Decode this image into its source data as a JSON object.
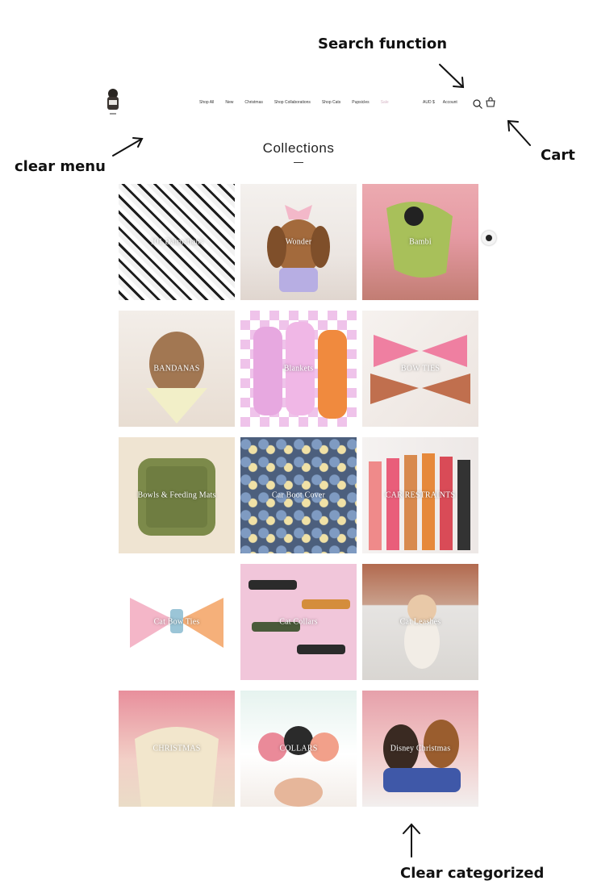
{
  "annotations": {
    "search": "Search function",
    "menu": "clear menu",
    "cart": "Cart",
    "categorized": "Clear categorized"
  },
  "header": {
    "nav": [
      "Shop All",
      "New",
      "Christmas",
      "Shop Collaborations",
      "Shop Cats",
      "Pupsicles",
      "Sale"
    ],
    "currency": "AUD $",
    "account": "Account"
  },
  "page_title": "Collections",
  "collections": [
    {
      "label": "101 Dalmatians"
    },
    {
      "label": "Wonder"
    },
    {
      "label": "Bambi"
    },
    {
      "label": "BANDANAS"
    },
    {
      "label": "Blankets"
    },
    {
      "label": "BOW TIES"
    },
    {
      "label": "Bowls & Feeding Mats"
    },
    {
      "label": "Car Boot Cover"
    },
    {
      "label": "CAR RESTRAINTS"
    },
    {
      "label": "Cat Bow Ties"
    },
    {
      "label": "Cat Collars"
    },
    {
      "label": "Cat Leashes"
    },
    {
      "label": "CHRISTMAS"
    },
    {
      "label": "COLLARS"
    },
    {
      "label": "Disney Christmas"
    }
  ]
}
